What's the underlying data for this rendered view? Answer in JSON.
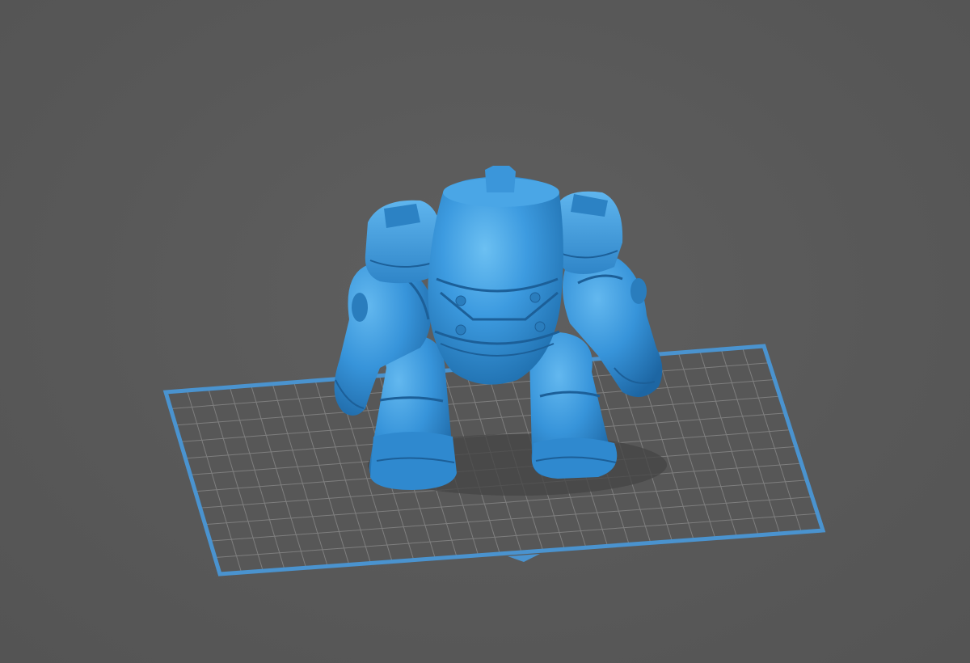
{
  "viewport": {
    "background_color": "#5a5a5a",
    "model_color": "#3a97d8",
    "plate_outline_color": "#4a93cf",
    "plate_grid_color": "#8a8a8a",
    "model_name": "robot-figure"
  }
}
